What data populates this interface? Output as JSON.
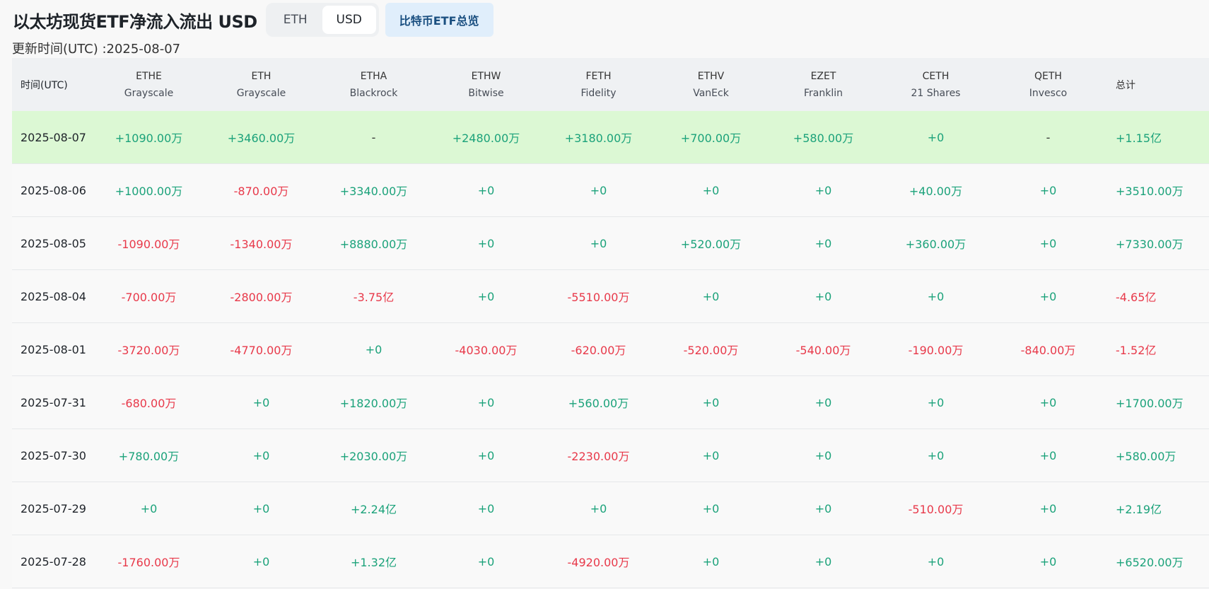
{
  "header": {
    "title": "以太坊现货ETF净流入流出 USD",
    "toggle": [
      {
        "label": "ETH",
        "active": false
      },
      {
        "label": "USD",
        "active": true
      }
    ],
    "overview_label": "比特币ETF总览",
    "update_time": "更新时间(UTC) :2025-08-07"
  },
  "colors": {
    "positive": "#1ba27a",
    "negative": "#e8394a",
    "highlight_row": "#dcf8d4"
  },
  "table": {
    "date_header": "时间(UTC)",
    "total_header": "总计",
    "funds": [
      {
        "ticker": "ETHE",
        "issuer": "Grayscale"
      },
      {
        "ticker": "ETH",
        "issuer": "Grayscale"
      },
      {
        "ticker": "ETHA",
        "issuer": "Blackrock"
      },
      {
        "ticker": "ETHW",
        "issuer": "Bitwise"
      },
      {
        "ticker": "FETH",
        "issuer": "Fidelity"
      },
      {
        "ticker": "ETHV",
        "issuer": "VanEck"
      },
      {
        "ticker": "EZET",
        "issuer": "Franklin"
      },
      {
        "ticker": "CETH",
        "issuer": "21 Shares"
      },
      {
        "ticker": "QETH",
        "issuer": "Invesco"
      }
    ],
    "rows": [
      {
        "date": "2025-08-07",
        "values": [
          "+1090.00万",
          "+3460.00万",
          "-",
          "+2480.00万",
          "+3180.00万",
          "+700.00万",
          "+580.00万",
          "+0",
          "-"
        ],
        "total": "+1.15亿"
      },
      {
        "date": "2025-08-06",
        "values": [
          "+1000.00万",
          "-870.00万",
          "+3340.00万",
          "+0",
          "+0",
          "+0",
          "+0",
          "+40.00万",
          "+0"
        ],
        "total": "+3510.00万"
      },
      {
        "date": "2025-08-05",
        "values": [
          "-1090.00万",
          "-1340.00万",
          "+8880.00万",
          "+0",
          "+0",
          "+520.00万",
          "+0",
          "+360.00万",
          "+0"
        ],
        "total": "+7330.00万"
      },
      {
        "date": "2025-08-04",
        "values": [
          "-700.00万",
          "-2800.00万",
          "-3.75亿",
          "+0",
          "-5510.00万",
          "+0",
          "+0",
          "+0",
          "+0"
        ],
        "total": "-4.65亿"
      },
      {
        "date": "2025-08-01",
        "values": [
          "-3720.00万",
          "-4770.00万",
          "+0",
          "-4030.00万",
          "-620.00万",
          "-520.00万",
          "-540.00万",
          "-190.00万",
          "-840.00万"
        ],
        "total": "-1.52亿"
      },
      {
        "date": "2025-07-31",
        "values": [
          "-680.00万",
          "+0",
          "+1820.00万",
          "+0",
          "+560.00万",
          "+0",
          "+0",
          "+0",
          "+0"
        ],
        "total": "+1700.00万"
      },
      {
        "date": "2025-07-30",
        "values": [
          "+780.00万",
          "+0",
          "+2030.00万",
          "+0",
          "-2230.00万",
          "+0",
          "+0",
          "+0",
          "+0"
        ],
        "total": "+580.00万"
      },
      {
        "date": "2025-07-29",
        "values": [
          "+0",
          "+0",
          "+2.24亿",
          "+0",
          "+0",
          "+0",
          "+0",
          "-510.00万",
          "+0"
        ],
        "total": "+2.19亿"
      },
      {
        "date": "2025-07-28",
        "values": [
          "-1760.00万",
          "+0",
          "+1.32亿",
          "+0",
          "-4920.00万",
          "+0",
          "+0",
          "+0",
          "+0"
        ],
        "total": "+6520.00万"
      }
    ]
  }
}
